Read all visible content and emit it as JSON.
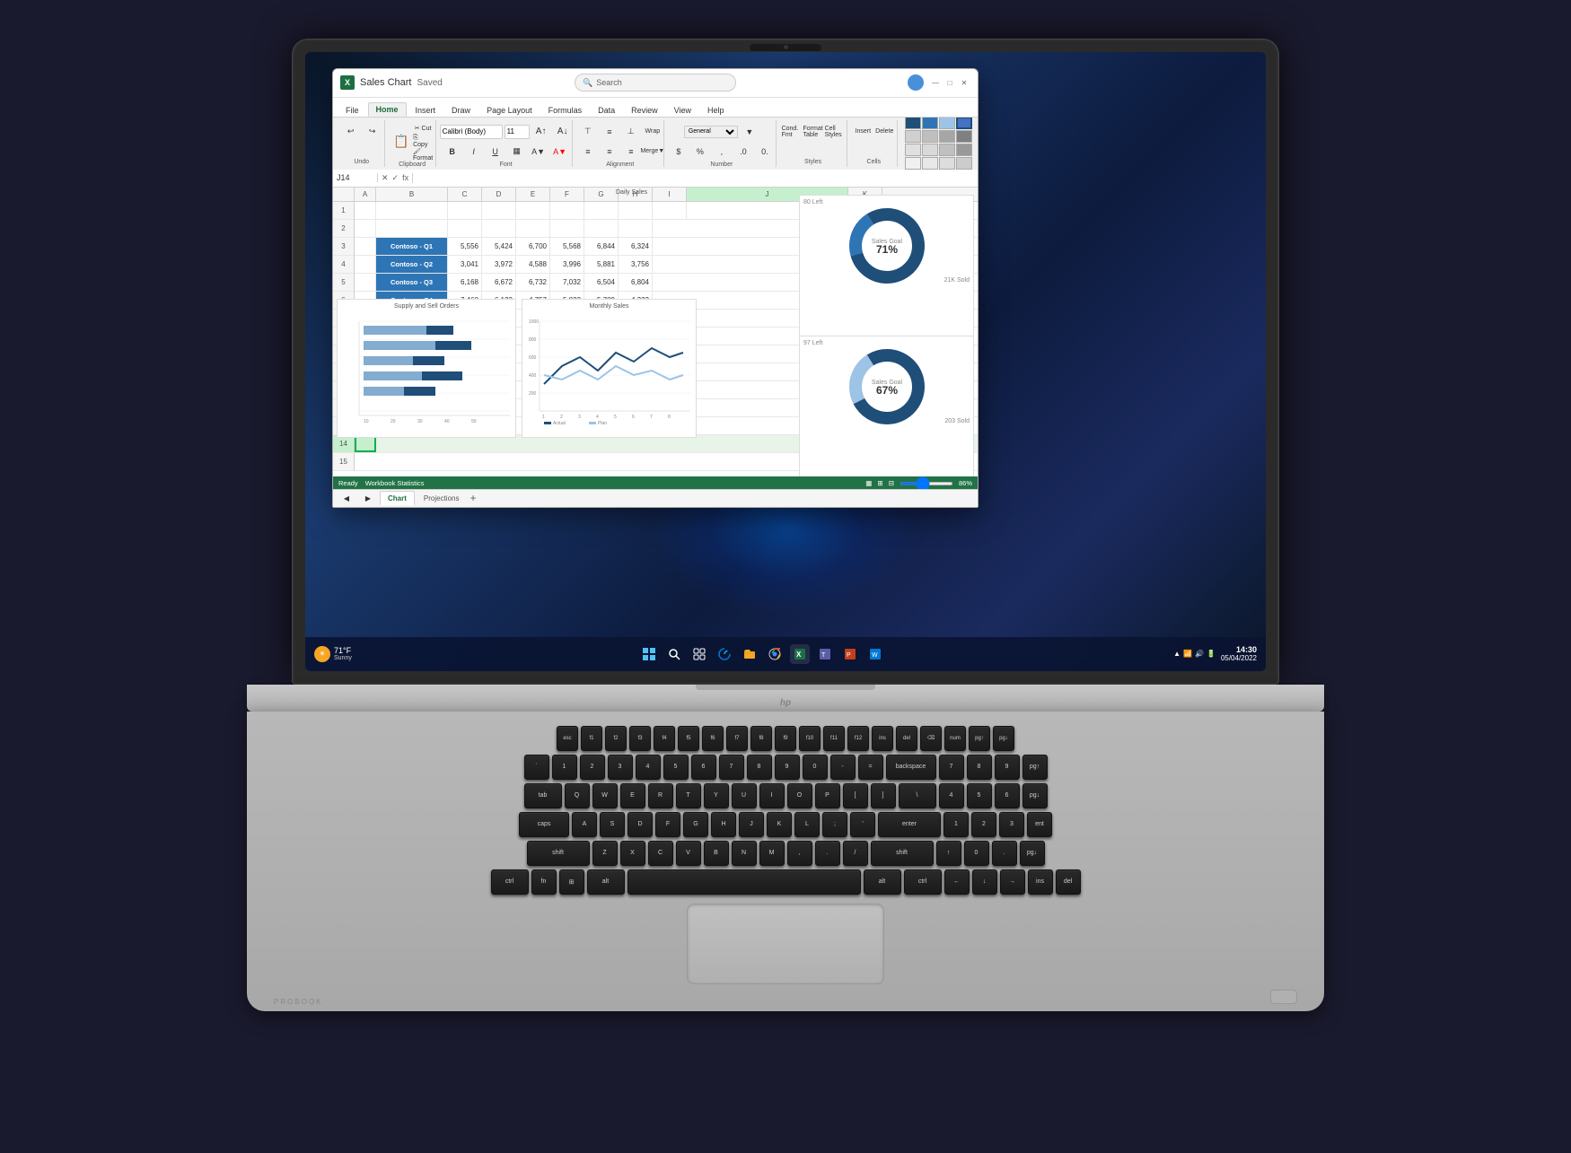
{
  "laptop": {
    "brand": "HP",
    "model": "ProBook",
    "screen": {
      "camera_alt": "webcam"
    }
  },
  "excel": {
    "title": "Sales Chart",
    "saved_status": "Saved",
    "search_placeholder": "Search",
    "cell_ref": "J14",
    "ribbon_tabs": [
      "File",
      "Home",
      "Insert",
      "Draw",
      "Page Layout",
      "Formulas",
      "Data",
      "Review",
      "View",
      "Help"
    ],
    "active_tab": "Home",
    "font_name": "Calibri (Body)",
    "font_size": "11",
    "sheet_tabs": [
      "Chart",
      "Projections"
    ],
    "active_sheet": "Chart",
    "status_left": "Ready",
    "status_workbook": "Workbook Statistics",
    "zoom": "86%",
    "table_headers": [
      "",
      "B",
      "C",
      "D",
      "E",
      "F",
      "G",
      "H"
    ],
    "table": {
      "header_row": [
        "",
        "",
        ""
      ],
      "data_rows": [
        {
          "label": "Contoso - Q1",
          "values": [
            "5,556",
            "5,424",
            "6,700",
            "5,568",
            "6,844",
            "6,324"
          ]
        },
        {
          "label": "Contoso - Q2",
          "values": [
            "3,041",
            "3,972",
            "4,588",
            "3,996",
            "5,881",
            "3,756"
          ]
        },
        {
          "label": "Contoso - Q3",
          "values": [
            "6,168",
            "6,672",
            "6,732",
            "7,032",
            "6,504",
            "6,804"
          ]
        },
        {
          "label": "Contoso - Q4",
          "values": [
            "7,460",
            "6,123",
            "4,757",
            "5,822",
            "5,789",
            "4,323"
          ]
        }
      ]
    },
    "donut1": {
      "title": "Daily Sales",
      "percentage": "71%",
      "center_label": "Sales Goal",
      "legend_left": "80 Left",
      "legend_right": "21K Sold"
    },
    "donut2": {
      "title": "",
      "percentage": "67%",
      "center_label": "Sales Goal",
      "legend_left": "97 Left",
      "legend_right": "203 Sold"
    },
    "chart1_title": "Supply and Sell Orders",
    "chart2_title": "Monthly Sales"
  },
  "taskbar": {
    "weather_temp": "71°F",
    "weather_condition": "Sunny",
    "time": "14:30",
    "date": "05/04/2022",
    "icons": [
      "windows-start-icon",
      "search-icon",
      "task-view-icon",
      "edge-icon",
      "explorer-icon",
      "chrome-icon",
      "mail-icon",
      "excel-icon",
      "teams-icon",
      "powerpoint-icon",
      "word-icon"
    ]
  },
  "keyboard": {
    "rows": [
      [
        "esc",
        "f1",
        "f2",
        "f3",
        "f4",
        "f5",
        "f6",
        "f7",
        "f8",
        "f9",
        "f10",
        "f11",
        "f12",
        "insert",
        "delete"
      ],
      [
        "`",
        "1",
        "2",
        "3",
        "4",
        "5",
        "6",
        "7",
        "8",
        "9",
        "0",
        "-",
        "=",
        "backspace"
      ],
      [
        "tab",
        "q",
        "w",
        "e",
        "r",
        "t",
        "y",
        "u",
        "i",
        "o",
        "p",
        "[",
        "]",
        "\\"
      ],
      [
        "caps",
        "a",
        "s",
        "d",
        "f",
        "g",
        "h",
        "j",
        "k",
        "l",
        ";",
        "'",
        "enter"
      ],
      [
        "shift",
        "z",
        "x",
        "c",
        "v",
        "b",
        "n",
        "m",
        ",",
        ".",
        "/",
        "shift"
      ],
      [
        "ctrl",
        "fn",
        "win",
        "alt",
        "space",
        "alt",
        "ctrl"
      ]
    ]
  }
}
